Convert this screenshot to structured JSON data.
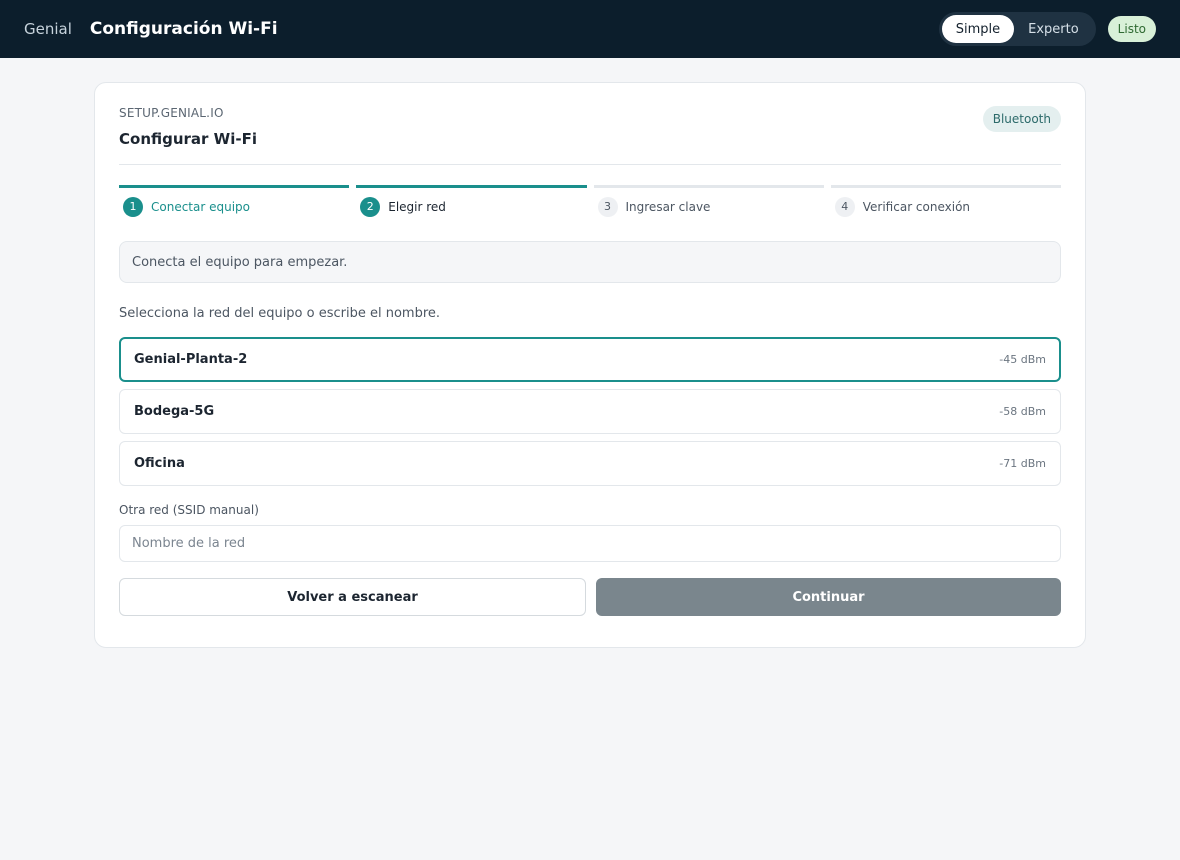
{
  "header": {
    "brand": "Genial",
    "title": "Configuración Wi-Fi",
    "modes": [
      {
        "label": "Simple",
        "active": true
      },
      {
        "label": "Experto",
        "active": false
      }
    ],
    "status": "Listo"
  },
  "card": {
    "domain": "SETUP.GENIAL.IO",
    "title": "Configurar Wi-Fi",
    "connection_badge": "Bluetooth"
  },
  "steps": [
    {
      "num": "1",
      "label": "Conectar equipo",
      "state": "done"
    },
    {
      "num": "2",
      "label": "Elegir red",
      "state": "current"
    },
    {
      "num": "3",
      "label": "Ingresar clave",
      "state": "pending"
    },
    {
      "num": "4",
      "label": "Verificar conexión",
      "state": "pending"
    }
  ],
  "notice": "Conecta el equipo para empezar.",
  "hint": "Selecciona la red del equipo o escribe el nombre.",
  "networks": [
    {
      "name": "Genial-Planta-2",
      "signal": "-45 dBm",
      "selected": true
    },
    {
      "name": "Bodega-5G",
      "signal": "-58 dBm",
      "selected": false
    },
    {
      "name": "Oficina",
      "signal": "-71 dBm",
      "selected": false
    }
  ],
  "manual": {
    "label": "Otra red (SSID manual)",
    "placeholder": "Nombre de la red",
    "value": ""
  },
  "actions": {
    "rescan_label": "Volver a escanear",
    "continue_label": "Continuar"
  },
  "colors": {
    "accent": "#1a8f8c",
    "topbar": "#0c1e2c",
    "primary_disabled": "#7a868d"
  }
}
